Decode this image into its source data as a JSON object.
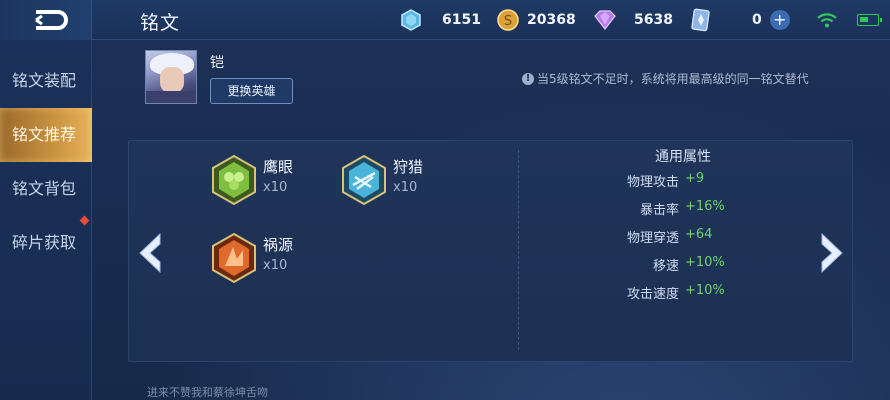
{
  "header": {
    "title": "铭文",
    "currencies": [
      {
        "name": "diamond",
        "icon": "blue-diamond-icon",
        "value": "6151"
      },
      {
        "name": "gold-coin",
        "icon": "gold-coin-icon",
        "value": "20368"
      },
      {
        "name": "purple-gem",
        "icon": "purple-gem-icon",
        "value": "5638"
      },
      {
        "name": "rune-crystal",
        "icon": "crystal-card-icon",
        "value": "0"
      }
    ],
    "plus_label": "+"
  },
  "sidebar": {
    "items": [
      {
        "label": "铭文装配",
        "active": false
      },
      {
        "label": "铭文推荐",
        "active": true
      },
      {
        "label": "铭文背包",
        "active": false
      },
      {
        "label": "碎片获取",
        "active": false
      }
    ]
  },
  "hero": {
    "name": "铠",
    "change_button": "更换英雄"
  },
  "notice": {
    "icon": "!",
    "text": "当5级铭文不足时，系统将用最高级的同一铭文替代"
  },
  "runes": [
    {
      "name": "鹰眼",
      "count": "x10",
      "color": "#7fbf3f",
      "icon": "hawk-eye-rune-icon"
    },
    {
      "name": "狩猎",
      "count": "x10",
      "color": "#4ab3d9",
      "icon": "hunt-rune-icon"
    },
    {
      "name": "祸源",
      "count": "x10",
      "color": "#e06a2c",
      "icon": "calamity-rune-icon"
    }
  ],
  "attributes": {
    "title": "通用属性",
    "rows": [
      {
        "label": "物理攻击",
        "value": "+9"
      },
      {
        "label": "暴击率",
        "value": "+16%"
      },
      {
        "label": "物理穿透",
        "value": "+64"
      },
      {
        "label": "移速",
        "value": "+10%"
      },
      {
        "label": "攻击速度",
        "value": "+10%"
      }
    ]
  },
  "footer": {
    "text": "进来不赞我和蔡徐坤舌吻"
  },
  "colors": {
    "accent": "#d29a45",
    "positive": "#6dd46d",
    "background": "#1a2d52"
  }
}
